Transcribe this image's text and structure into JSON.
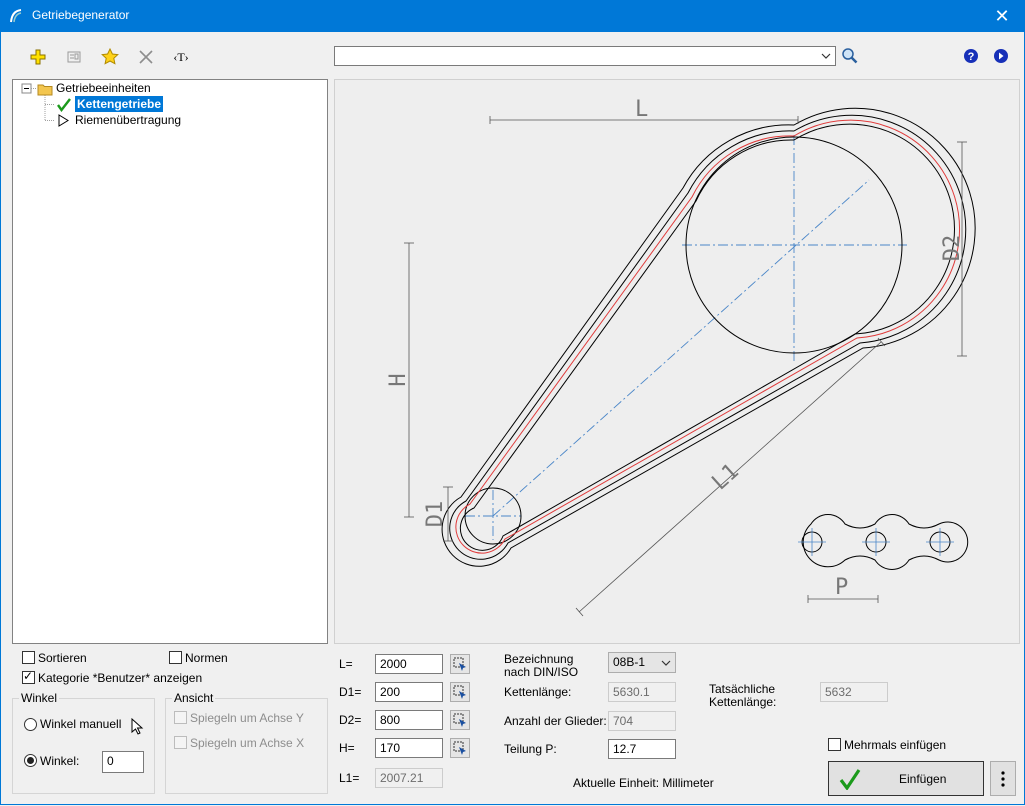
{
  "window": {
    "title": "Getriebegenerator"
  },
  "toolbar": {
    "icons": [
      "add-icon",
      "properties-icon",
      "favorite-star-icon",
      "delete-icon",
      "text-tag-icon"
    ],
    "text_tag_label": "‹T›",
    "search_value": "",
    "help_icon": "help-icon",
    "info_icon": "forward-icon"
  },
  "tree": {
    "root": "Getriebeeinheiten",
    "items": [
      "Kettengetriebe",
      "Riemenübertragung"
    ],
    "selected": "Kettengetriebe"
  },
  "drawing_labels": {
    "L": "L",
    "D2": "D2",
    "H": "H",
    "L1": "L1",
    "D1": "D1",
    "P": "P"
  },
  "options": {
    "sortieren": "Sortieren",
    "normen": "Normen",
    "kategorie": "Kategorie *Benutzer* anzeigen"
  },
  "winkel": {
    "title": "Winkel",
    "manuell": "Winkel manuell",
    "winkel_label": "Winkel:",
    "winkel_value": "0"
  },
  "ansicht": {
    "title": "Ansicht",
    "spiegeln_y": "Spiegeln um Achse Y",
    "spiegeln_x": "Spiegeln um Achse X"
  },
  "params": {
    "L": {
      "label": "L=",
      "value": "2000"
    },
    "D1": {
      "label": "D1=",
      "value": "200"
    },
    "D2": {
      "label": "D2=",
      "value": "800"
    },
    "H": {
      "label": "H=",
      "value": "170"
    },
    "L1": {
      "label": "L1=",
      "value": "2007.21"
    }
  },
  "chain": {
    "bezeichnung_label": "Bezeichnung nach DIN/ISO",
    "bezeichnung_value": "08B-1",
    "kettenlaenge_label": "Kettenlänge:",
    "kettenlaenge_value": "5630.1",
    "glieder_label": "Anzahl der Glieder:",
    "glieder_value": "704",
    "teilung_label": "Teilung P:",
    "teilung_value": "12.7",
    "tatsaechlich_label": "Tatsächliche Kettenlänge:",
    "tatsaechlich_value": "5632",
    "einheit": "Aktuelle Einheit: Millimeter"
  },
  "actions": {
    "mehrmals": "Mehrmals einfügen",
    "einfuegen": "Einfügen"
  },
  "colors": {
    "accent": "#0078d7",
    "chain_red": "#e03a3a",
    "centerline": "#4a86c8"
  }
}
